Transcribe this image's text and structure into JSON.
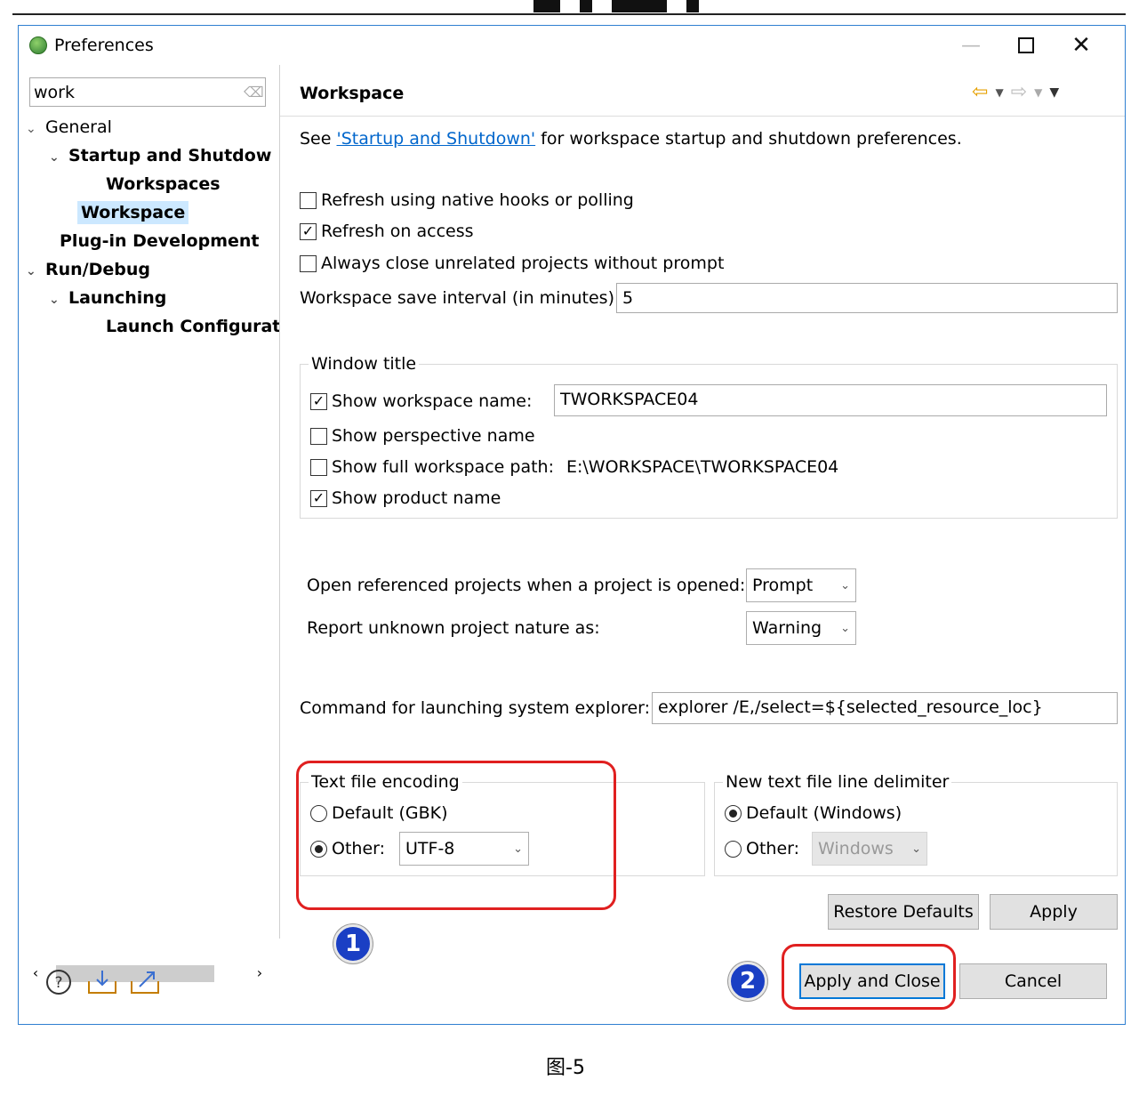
{
  "window": {
    "title": "Preferences"
  },
  "left": {
    "filter_value": "work",
    "tree": [
      {
        "label": "General"
      },
      {
        "label": "Startup and Shutdow"
      },
      {
        "label": "Workspaces"
      },
      {
        "label": "Workspace"
      },
      {
        "label": "Plug-in Development"
      },
      {
        "label": "Run/Debug"
      },
      {
        "label": "Launching"
      },
      {
        "label": "Launch Configurat"
      }
    ]
  },
  "page": {
    "title": "Workspace",
    "intro_prefix": "See ",
    "intro_link": "'Startup and Shutdown'",
    "intro_suffix": " for workspace startup and shutdown preferences.",
    "refresh_native": "Refresh using native hooks or polling",
    "refresh_access": "Refresh on access",
    "close_unrelated": "Always close unrelated projects without prompt",
    "save_interval_label": "Workspace save interval (in minutes):",
    "save_interval_value": "5",
    "window_title_group": "Window title",
    "show_ws_name": "Show workspace name:",
    "ws_name_value": "TWORKSPACE04",
    "show_perspective": "Show perspective name",
    "show_full_path": "Show full workspace path:",
    "full_path_value": "E:\\WORKSPACE\\TWORKSPACE04",
    "show_product": "Show product name",
    "open_ref_label": "Open referenced projects when a project is opened:",
    "open_ref_value": "Prompt",
    "report_label": "Report unknown project nature as:",
    "report_value": "Warning",
    "explorer_label": "Command for launching system explorer:",
    "explorer_value": "explorer /E,/select=${selected_resource_loc}",
    "encoding_group": "Text file encoding",
    "enc_default": "Default (GBK)",
    "enc_other": "Other:",
    "enc_other_value": "UTF-8",
    "delim_group": "New text file line delimiter",
    "delim_default": "Default (Windows)",
    "delim_other": "Other:",
    "delim_other_value": "Windows",
    "restore_defaults": "Restore Defaults",
    "apply": "Apply"
  },
  "footer": {
    "apply_close": "Apply and Close",
    "cancel": "Cancel"
  },
  "annotations": {
    "badge1": "1",
    "badge2": "2",
    "accent": "#e02020",
    "badge_color": "#1a3fc4"
  },
  "caption": "图-5"
}
